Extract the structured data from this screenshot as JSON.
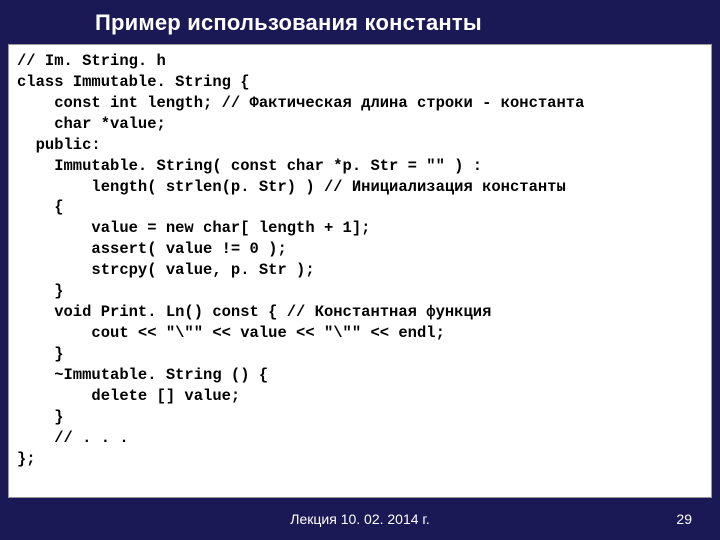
{
  "title": "Пример использования константы",
  "code": "// Im. String. h\nclass Immutable. String {\n    const int length; // Фактическая длина строки - константа\n    char *value;\n  public:\n    Immutable. String( const char *p. Str = \"\" ) :\n        length( strlen(p. Str) ) // Инициализация константы\n    {\n        value = new char[ length + 1];\n        assert( value != 0 );\n        strcpy( value, p. Str );\n    }\n    void Print. Ln() const { // Константная функция\n        cout << \"\\\"\" << value << \"\\\"\" << endl;\n    }\n    ~Immutable. String () {\n        delete [] value;\n    }\n    // . . .\n};",
  "footer": {
    "lecture": "Лекция 10. 02. 2014 г.",
    "page": "29"
  }
}
